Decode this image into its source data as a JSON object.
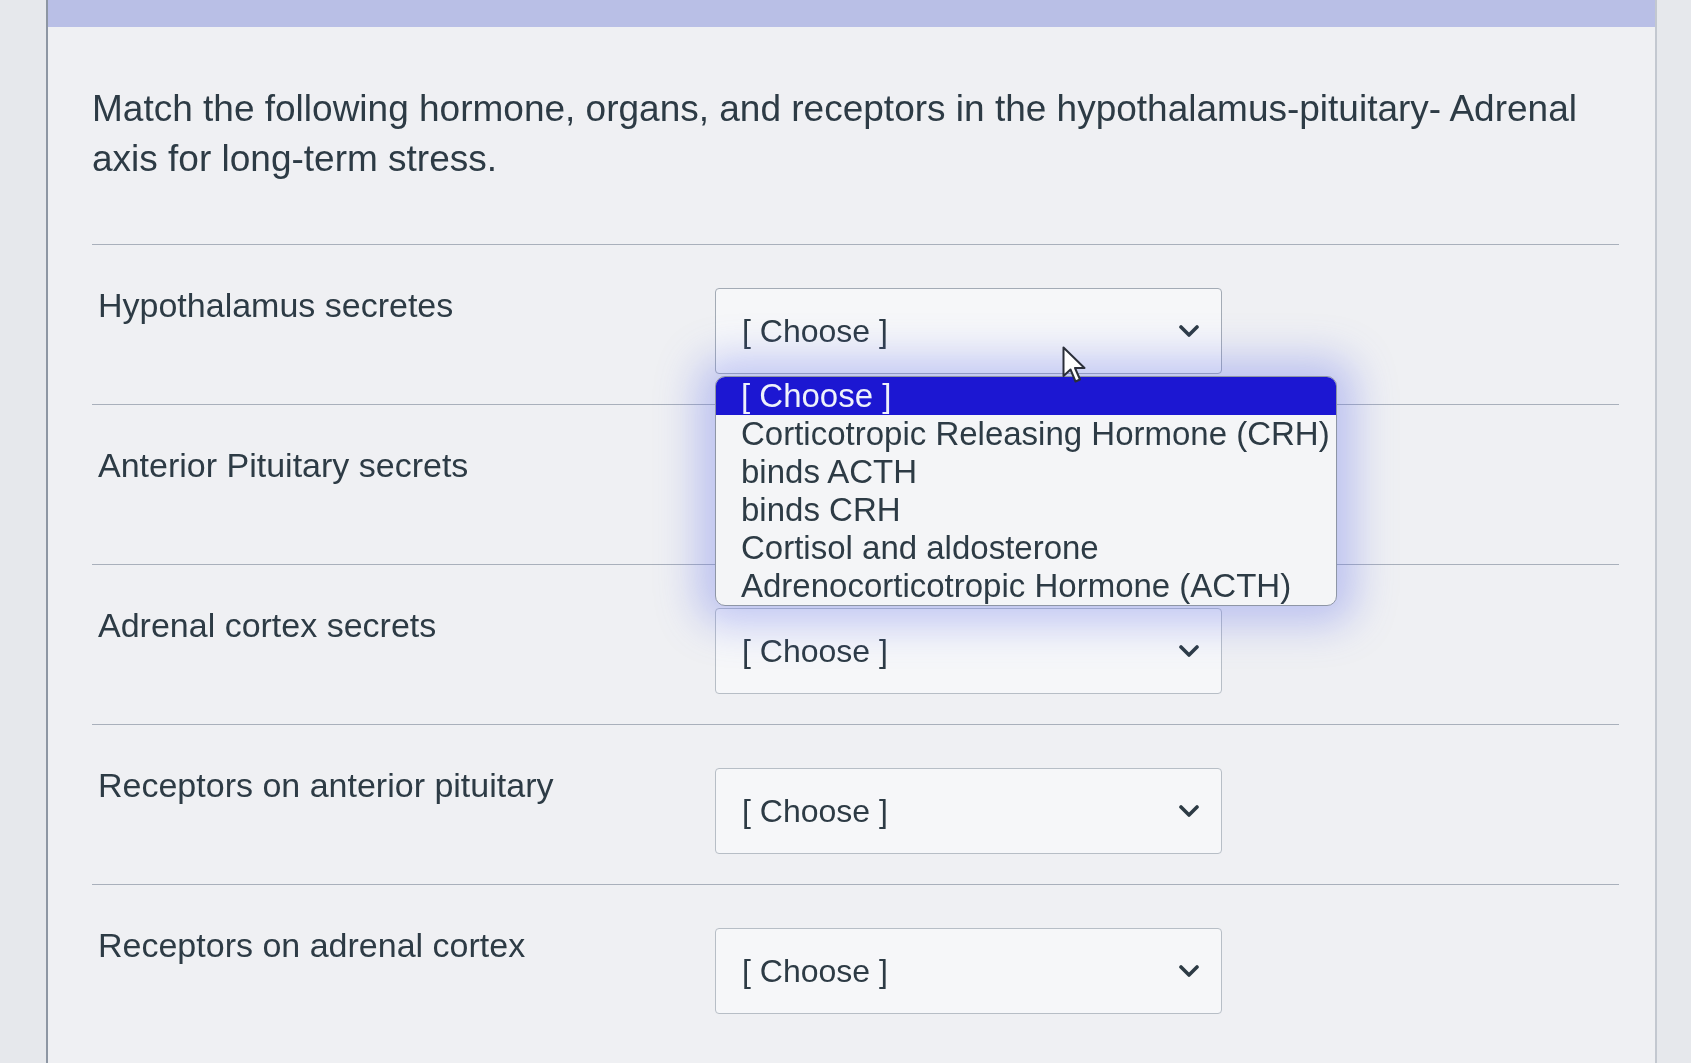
{
  "question": {
    "text": "Match the following hormone, organs, and receptors in the hypothalamus-pituitary- Adrenal axis for long-term stress."
  },
  "rows": [
    {
      "label": "Hypothalamus secretes",
      "select": {
        "value": "[ Choose ]",
        "open": true,
        "options": [
          {
            "label": "[ Choose ]",
            "selected": true
          },
          {
            "label": "Corticotropic Releasing Hormone (CRH)",
            "selected": false
          },
          {
            "label": "binds ACTH",
            "selected": false
          },
          {
            "label": "binds CRH",
            "selected": false
          },
          {
            "label": "Cortisol and aldosterone",
            "selected": false
          },
          {
            "label": "Adrenocorticotropic Hormone (ACTH)",
            "selected": false
          }
        ]
      }
    },
    {
      "label": "Anterior Pituitary secrets"
    },
    {
      "label": "Adrenal cortex secrets",
      "select": {
        "value": "[ Choose ]",
        "open": false
      }
    },
    {
      "label": "Receptors on anterior pituitary",
      "select": {
        "value": "[ Choose ]",
        "open": false
      }
    },
    {
      "label": "Receptors on adrenal cortex",
      "select": {
        "value": "[ Choose ]",
        "open": false
      }
    }
  ]
}
